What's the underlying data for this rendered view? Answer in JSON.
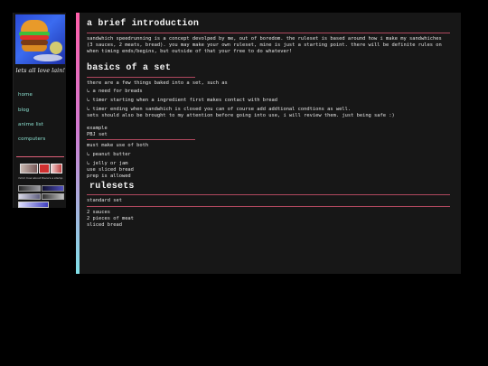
{
  "sidebar": {
    "tagline": "lets all love lain!",
    "nav": [
      {
        "label": "home"
      },
      {
        "label": "blog"
      },
      {
        "label": "anime list"
      },
      {
        "label": "computers"
      }
    ],
    "stamp_caption": "hmm how about there's a stamp"
  },
  "sections": {
    "intro": {
      "title": "a brief introduction",
      "body": "sandwhich speedrunning is a concept devolped by me, out of boredom. the ruleset is based around how i make my sandwhiches (3 sauces, 2 meats, bread). you may make your own ruleset, mine is just a starting point. there will be definite rules on when timing ends/begins, but outside of that your free to do whatever!"
    },
    "basics": {
      "title": "basics of a set",
      "lead": "there are a few things baked into a set, such as",
      "items": [
        "↳ a need for breads",
        "↳ timer starting when a ingredient first makes contact with bread",
        "↳ timer ending when sandwhich is closed you can of course add addtional condtions as well."
      ],
      "note": "sets should also be brought to my attention before going into use, i will review them. just being safe :)",
      "example_label": "example",
      "example_name": "PBJ set",
      "must_label": "must make use of both",
      "must_items": [
        "↳ peanut butter",
        "↳ jelly or jam"
      ],
      "rules": [
        "use sliced bread",
        "prep is allowed"
      ]
    },
    "rulesets": {
      "title": "rulesets",
      "set_name": "standard set",
      "rules": [
        "2 sauces",
        "2 pieces of meat",
        "sliced bread"
      ]
    }
  },
  "colors": {
    "accent_rule": "#b0485e",
    "link": "#8be0d0",
    "panel": "#171717"
  }
}
